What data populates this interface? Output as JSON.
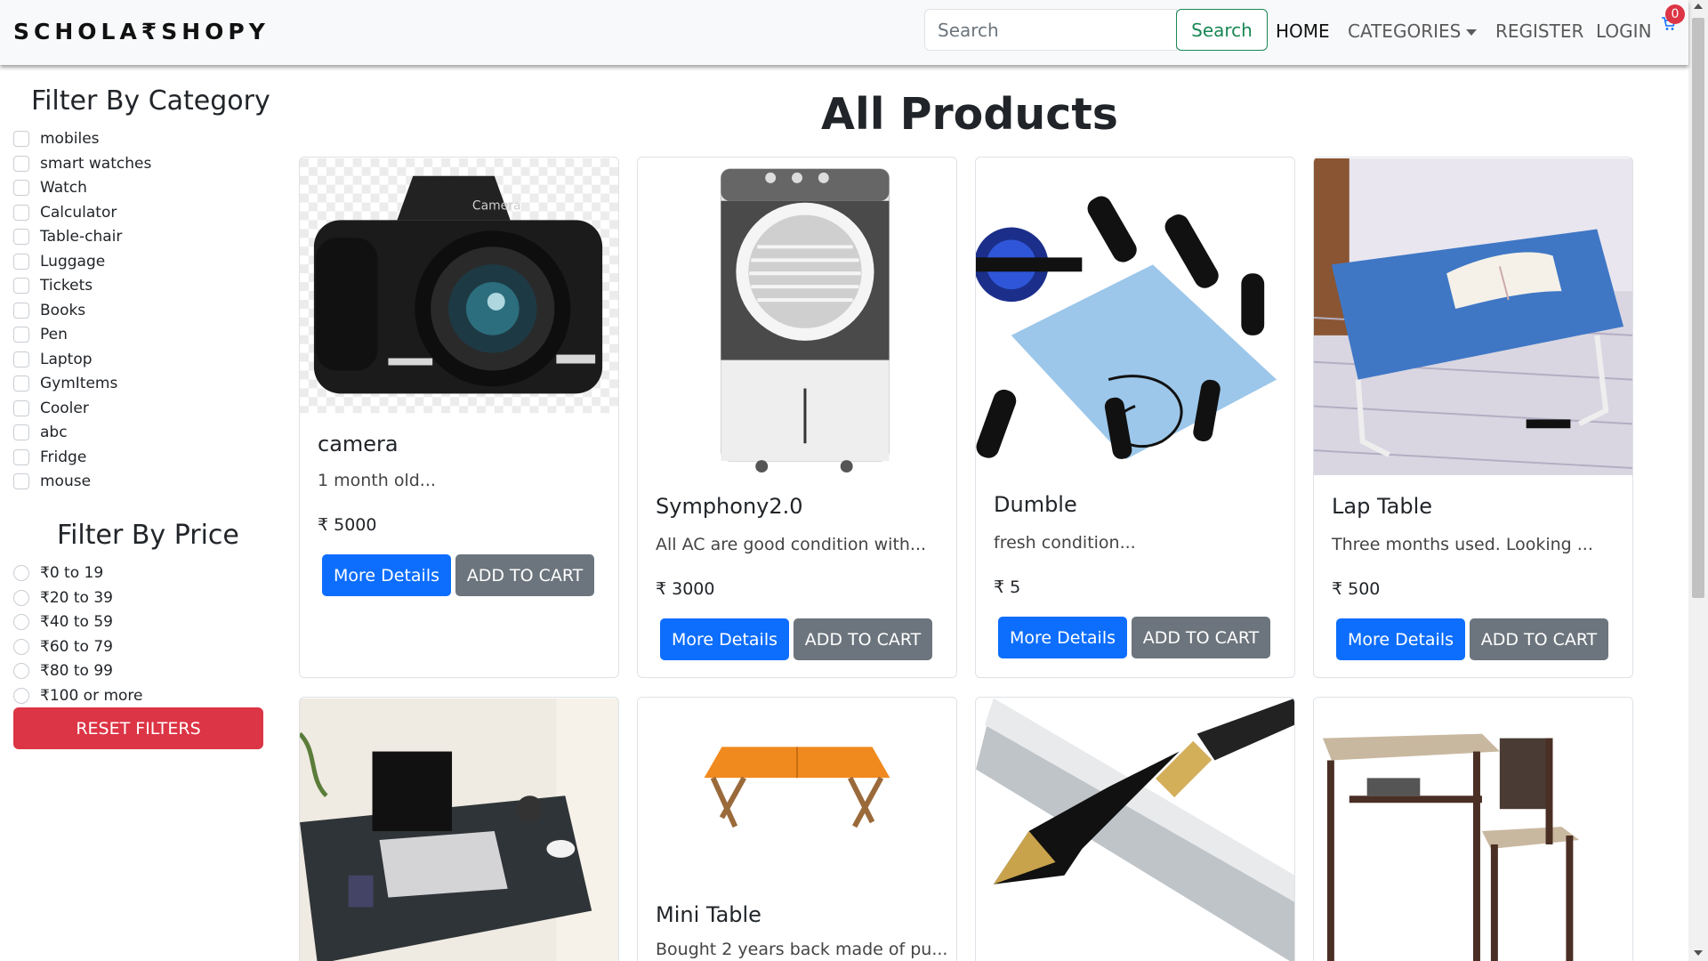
{
  "navbar": {
    "brand": "SCHOLA₹SHOPY",
    "search_placeholder": "Search",
    "search_button": "Search",
    "links": {
      "home": "HOME",
      "categories": "CATEGORIES",
      "register": "REGISTER",
      "login": "LOGIN"
    },
    "cart_count": "0"
  },
  "sidebar": {
    "category_heading": "Filter By Category",
    "categories": [
      "mobiles",
      "smart watches",
      "Watch",
      "Calculator",
      "Table-chair",
      "Luggage",
      "Tickets",
      "Books",
      "Pen",
      "Laptop",
      "GymItems",
      "Cooler",
      "abc",
      "Fridge",
      "mouse"
    ],
    "price_heading": "Filter By Price",
    "prices": [
      "₹0 to 19",
      "₹20 to 39",
      "₹40 to 59",
      "₹60 to 79",
      "₹80 to 99",
      "₹100 or more"
    ],
    "reset_button": "RESET FILTERS"
  },
  "main": {
    "title": "All Products",
    "more_details_label": "More Details",
    "add_to_cart_label": "ADD TO CART",
    "products": [
      {
        "name": "camera",
        "description": "1 month old...",
        "price": "₹ 5000",
        "image": "camera-image"
      },
      {
        "name": "Symphony2.0",
        "description": "All AC are good condition with...",
        "price": "₹ 3000",
        "image": "air-cooler-image"
      },
      {
        "name": "Dumble",
        "description": "fresh condition...",
        "price": "₹ 5",
        "image": "gym-kit-image"
      },
      {
        "name": "Lap Table",
        "description": "Three months used. Looking ...",
        "price": "₹ 500",
        "image": "lap-table-image"
      },
      {
        "name": "",
        "description": "",
        "price": "",
        "image": "laptop-desk-image"
      },
      {
        "name": "Mini Table",
        "description": "Bought 2 years back made of pu...",
        "price": "",
        "image": "mini-table-image"
      },
      {
        "name": "",
        "description": "",
        "price": "",
        "image": "fountain-pen-image"
      },
      {
        "name": "",
        "description": "",
        "price": "",
        "image": "table-chair-image"
      }
    ]
  },
  "colors": {
    "primary": "#0d6efd",
    "secondary": "#6c757d",
    "danger": "#dc3545",
    "success": "#198754",
    "navbar_bg": "#f8f9fa"
  }
}
